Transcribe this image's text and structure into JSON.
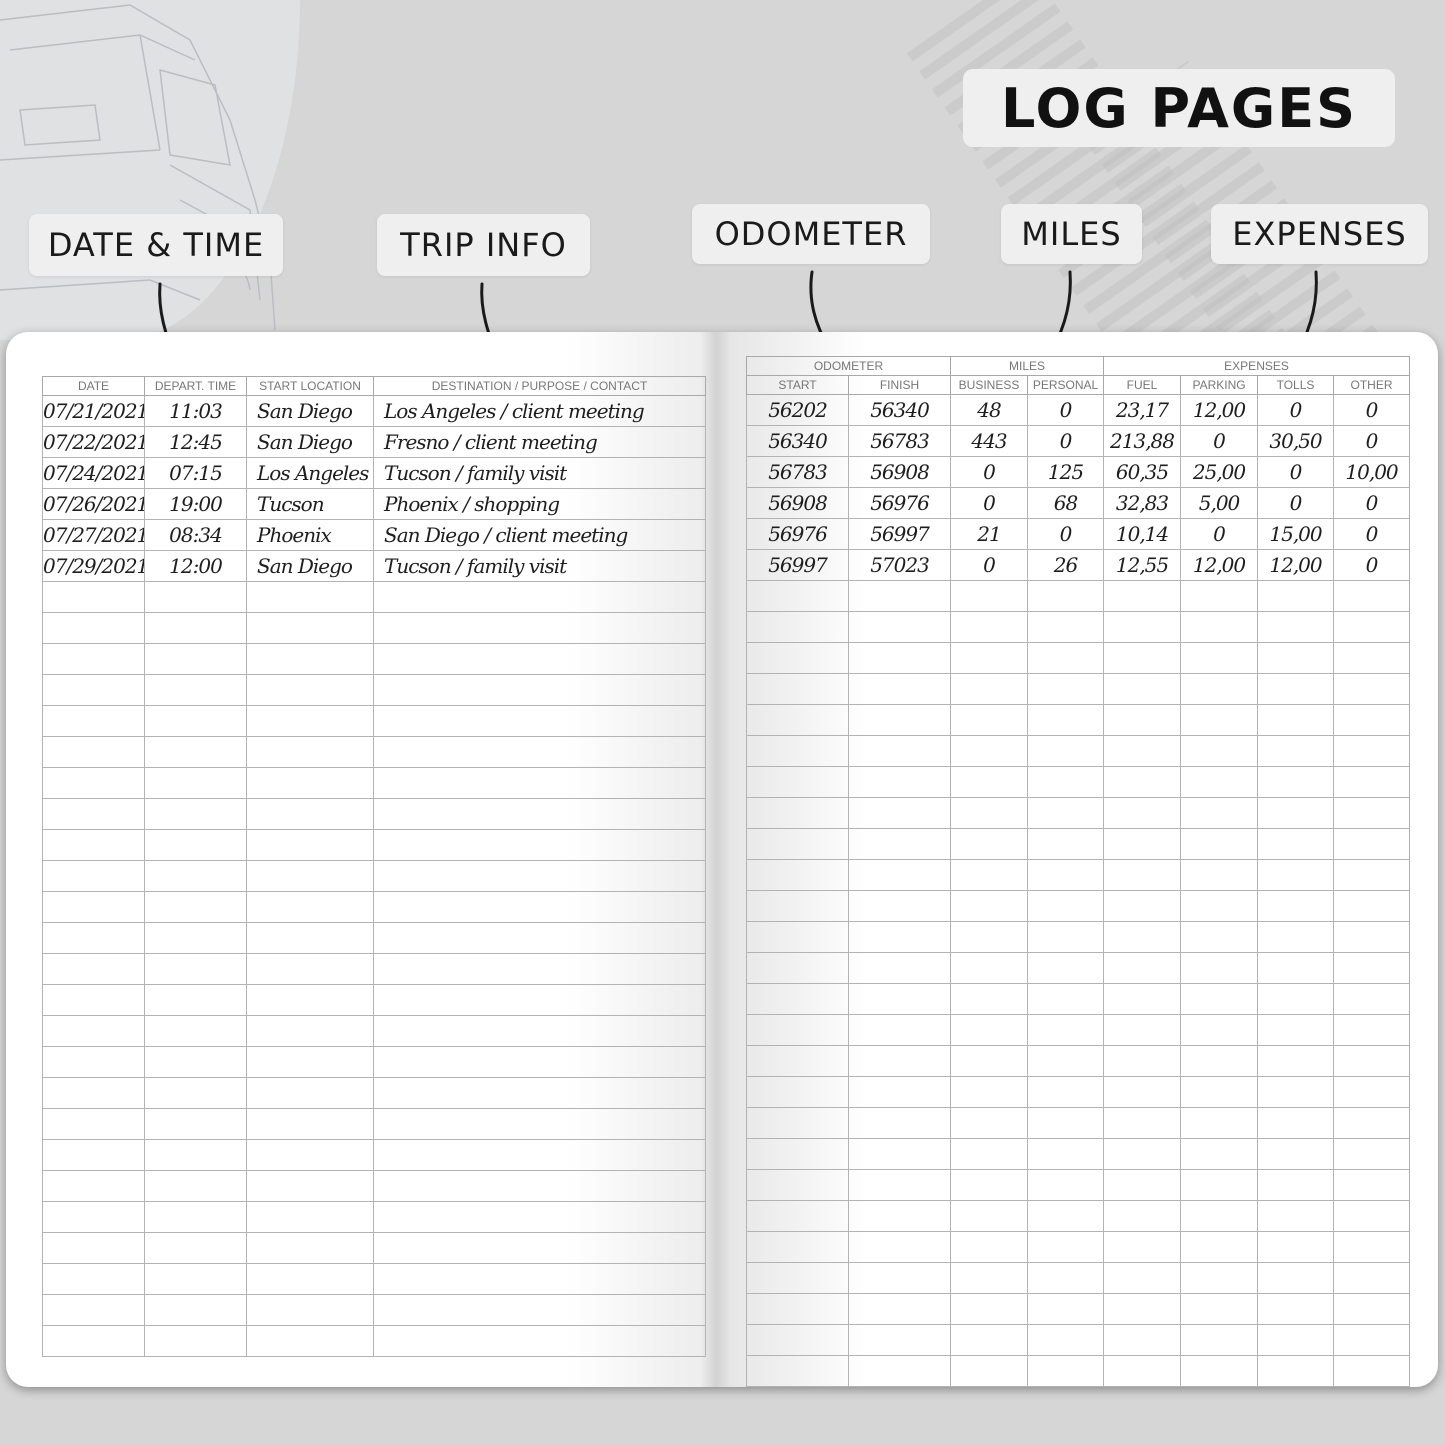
{
  "title": "LOG PAGES",
  "labels": {
    "date_time": "DATE & TIME",
    "trip_info": "TRIP INFO",
    "odometer": "ODOMETER",
    "miles": "MILES",
    "expenses": "EXPENSES"
  },
  "left_page": {
    "headers": [
      "DATE",
      "DEPART. TIME",
      "START LOCATION",
      "DESTINATION / PURPOSE / CONTACT"
    ],
    "rows": [
      [
        "07/21/2021",
        "11:03",
        "San Diego",
        "Los Angeles / client meeting"
      ],
      [
        "07/22/2021",
        "12:45",
        "San Diego",
        "Fresno / client meeting"
      ],
      [
        "07/24/2021",
        "07:15",
        "Los Angeles",
        "Tucson / family visit"
      ],
      [
        "07/26/2021",
        "19:00",
        "Tucson",
        "Phoenix / shopping"
      ],
      [
        "07/27/2021",
        "08:34",
        "Phoenix",
        "San Diego / client meeting"
      ],
      [
        "07/29/2021",
        "12:00",
        "San Diego",
        "Tucson / family visit"
      ]
    ]
  },
  "right_page": {
    "group_headers": [
      "ODOMETER",
      "MILES",
      "EXPENSES"
    ],
    "headers": [
      "START",
      "FINISH",
      "BUSINESS",
      "PERSONAL",
      "FUEL",
      "PARKING",
      "TOLLS",
      "OTHER"
    ],
    "rows": [
      [
        "56202",
        "56340",
        "48",
        "0",
        "23,17",
        "12,00",
        "0",
        "0"
      ],
      [
        "56340",
        "56783",
        "443",
        "0",
        "213,88",
        "0",
        "30,50",
        "0"
      ],
      [
        "56783",
        "56908",
        "0",
        "125",
        "60,35",
        "25,00",
        "0",
        "10,00"
      ],
      [
        "56908",
        "56976",
        "0",
        "68",
        "32,83",
        "5,00",
        "0",
        "0"
      ],
      [
        "56976",
        "56997",
        "21",
        "0",
        "10,14",
        "0",
        "15,00",
        "0"
      ],
      [
        "56997",
        "57023",
        "0",
        "26",
        "12,55",
        "12,00",
        "12,00",
        "0"
      ]
    ]
  },
  "colors": {
    "background": "#d6d6d6",
    "page": "#ffffff",
    "label_bg": "#efefef",
    "ink": "#1e1e1e"
  }
}
